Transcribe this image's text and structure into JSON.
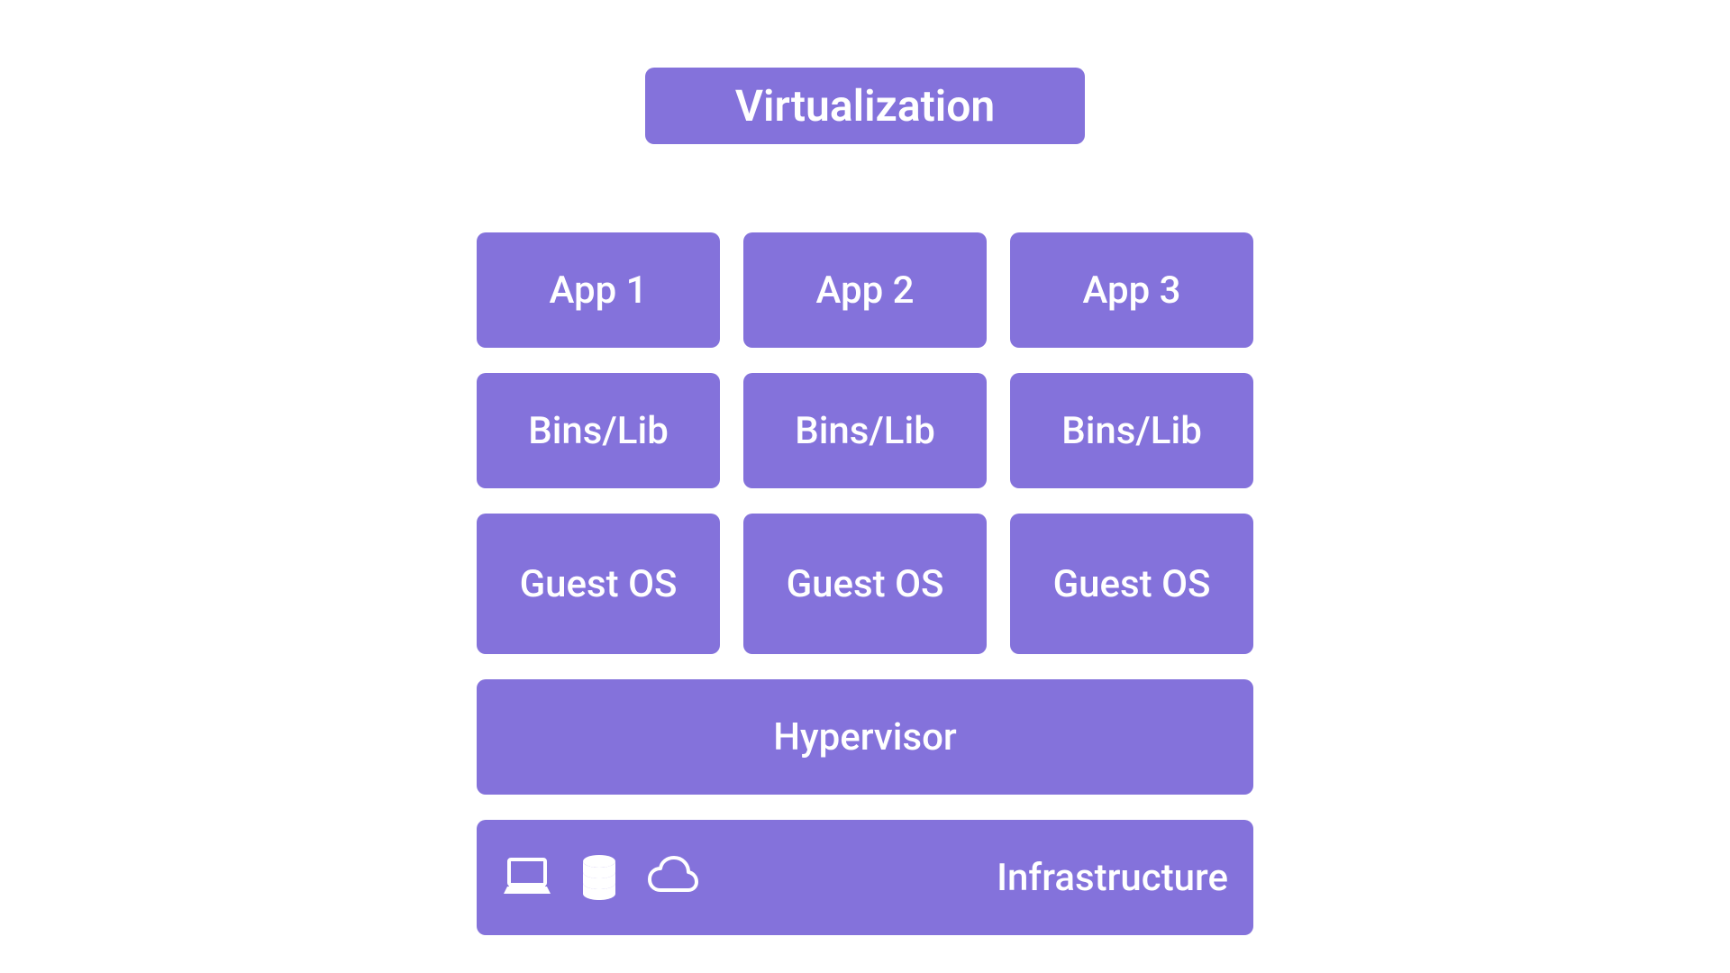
{
  "title": "Virtualization",
  "columns": [
    {
      "app": "App 1",
      "bins": "Bins/Lib",
      "os": "Guest OS"
    },
    {
      "app": "App 2",
      "bins": "Bins/Lib",
      "os": "Guest OS"
    },
    {
      "app": "App 3",
      "bins": "Bins/Lib",
      "os": "Guest OS"
    }
  ],
  "hypervisor": "Hypervisor",
  "infrastructure": "Infrastructure",
  "colors": {
    "block": "#8472db",
    "text": "#ffffff"
  }
}
